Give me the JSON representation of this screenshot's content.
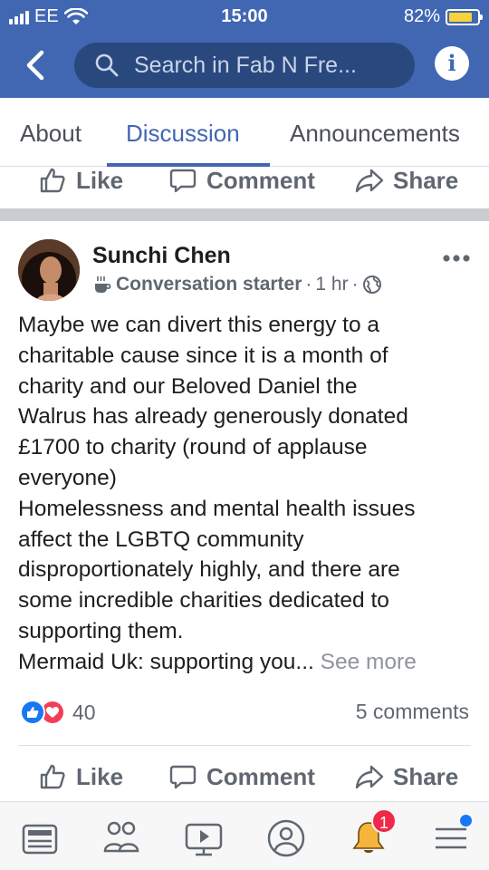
{
  "status_bar": {
    "carrier": "EE",
    "time": "15:00",
    "battery": "82%",
    "battery_level": 0.82
  },
  "header": {
    "search_placeholder": "Search in Fab N Fre..."
  },
  "tabs": [
    {
      "label": "About",
      "active": false
    },
    {
      "label": "Discussion",
      "active": true
    },
    {
      "label": "Announcements",
      "active": false
    }
  ],
  "actions": {
    "like": "Like",
    "comment": "Comment",
    "share": "Share"
  },
  "post": {
    "author": "Sunchi Chen",
    "badge": "Conversation starter",
    "time": "1 hr",
    "lines": [
      "Maybe we can divert this energy to a",
      "charitable cause since it is a month of",
      "charity and our Beloved Daniel the",
      "Walrus has already generously donated",
      "£1700 to charity (round of applause",
      "everyone)",
      "Homelessness and mental health issues",
      "affect the LGBTQ community",
      "disproportionately highly, and there are",
      "some incredible charities dedicated to",
      "supporting them."
    ],
    "last_line": "Mermaid Uk: supporting you...",
    "see_more": "See more",
    "reaction_count": "40",
    "comments_count": "5 comments"
  },
  "bottom_nav": {
    "notification_count": "1",
    "icons": [
      "news-feed-icon",
      "groups-icon",
      "watch-icon",
      "profile-icon",
      "notifications-icon",
      "menu-icon"
    ]
  },
  "colors": {
    "brand": "#4267b2",
    "search_bg": "#29487d",
    "like": "#1877f2",
    "love": "#f33e58",
    "badge": "#f02849"
  }
}
